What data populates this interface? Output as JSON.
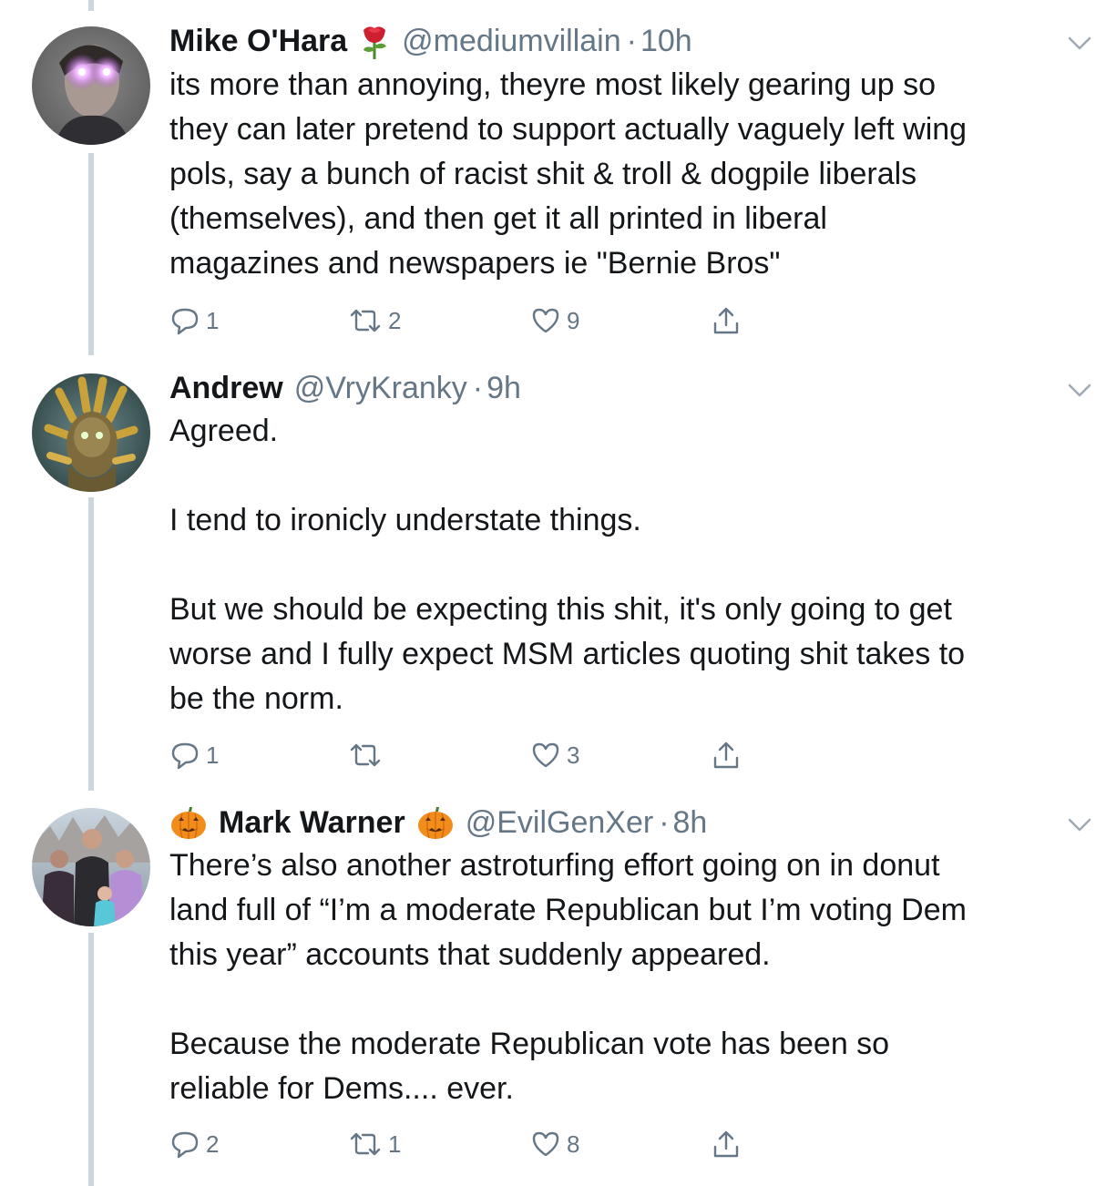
{
  "tweets": [
    {
      "display_name": "Mike O'Hara",
      "name_suffix_icon": "rose-icon",
      "handle": "@mediumvillain",
      "time": "10h",
      "body": [
        "its more than annoying, theyre most likely gearing up so",
        "they can later pretend to support actually vaguely left wing",
        "pols, say a bunch of racist shit & troll & dogpile liberals",
        "(themselves), and then get it all printed in liberal",
        "magazines and newspapers ie \"Bernie Bros\""
      ],
      "replies": "1",
      "retweets": "2",
      "likes": "9"
    },
    {
      "display_name": "Andrew",
      "handle": "@VryKranky",
      "time": "9h",
      "body": [
        "Agreed.",
        "",
        "I tend to ironicly understate things.",
        "",
        "But we should be expecting this shit, it's only going to get",
        "worse and I fully expect MSM articles quoting shit takes to",
        "be the norm."
      ],
      "replies": "1",
      "retweets": "",
      "likes": "3"
    },
    {
      "display_name": "Mark Warner",
      "name_prefix_icon": "jack-o-lantern-icon",
      "name_suffix_icon": "jack-o-lantern-icon",
      "handle": "@EvilGenXer",
      "time": "8h",
      "body": [
        "There’s also another astroturfing effort going on in donut",
        "land full of “I’m a moderate Republican but I’m voting Dem",
        "this year” accounts that suddenly appeared.",
        "",
        "Because the moderate Republican vote has been so",
        "reliable for Dems.... ever."
      ],
      "replies": "2",
      "retweets": "1",
      "likes": "8"
    }
  ],
  "separator": "·",
  "colors": {
    "text": "#14171a",
    "muted": "#657786",
    "thread_line": "#ccd6dd",
    "background": "#ffffff"
  },
  "icons": {
    "reply": "reply-icon",
    "retweet": "retweet-icon",
    "like": "heart-icon",
    "share": "share-icon",
    "caret": "chevron-down-icon"
  }
}
